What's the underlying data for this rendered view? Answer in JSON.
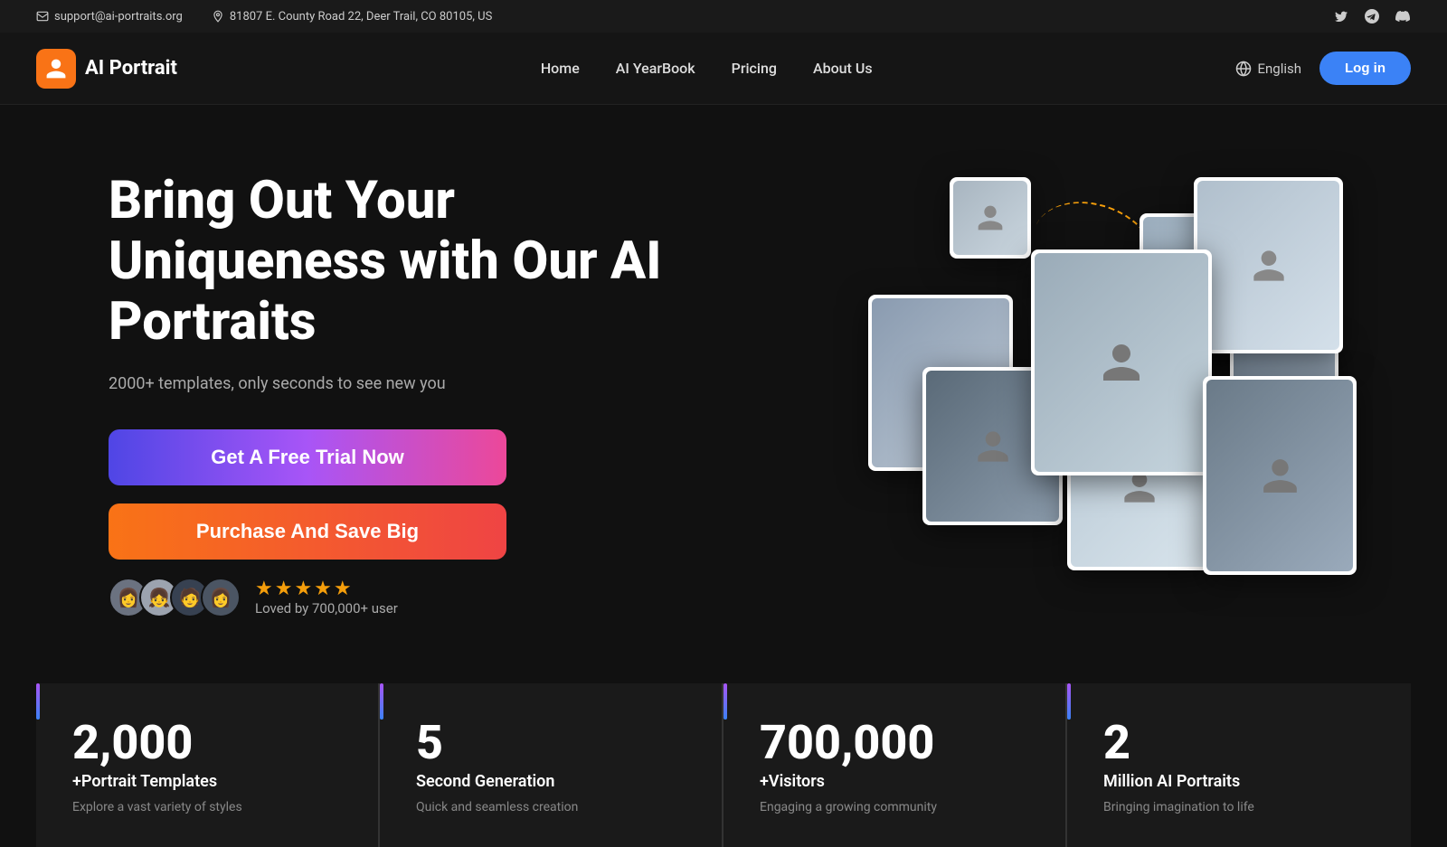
{
  "topbar": {
    "email": "support@ai-portraits.org",
    "address": "81807 E. County Road 22, Deer Trail, CO 80105, US"
  },
  "nav": {
    "logo_text": "AI Portrait",
    "links": [
      {
        "label": "Home",
        "id": "home"
      },
      {
        "label": "AI YearBook",
        "id": "yearbook"
      },
      {
        "label": "Pricing",
        "id": "pricing"
      },
      {
        "label": "About Us",
        "id": "about"
      }
    ],
    "lang": "English",
    "login": "Log in"
  },
  "hero": {
    "title": "Bring Out Your Uniqueness with Our AI Portraits",
    "subtitle": "2000+ templates, only seconds to see new you",
    "btn_trial": "Get A Free Trial Now",
    "btn_purchase": "Purchase And Save Big",
    "social_proof": "Loved by 700,000+ user"
  },
  "stats": [
    {
      "number": "2,000",
      "label": "+Portrait Templates",
      "desc": "Explore a vast variety of styles"
    },
    {
      "number": "5",
      "label": "Second Generation",
      "desc": "Quick and seamless creation"
    },
    {
      "number": "700,000",
      "label": "+Visitors",
      "desc": "Engaging a growing community"
    },
    {
      "number": "2",
      "label": "Million AI Portraits",
      "desc": "Bringing imagination to life"
    }
  ]
}
